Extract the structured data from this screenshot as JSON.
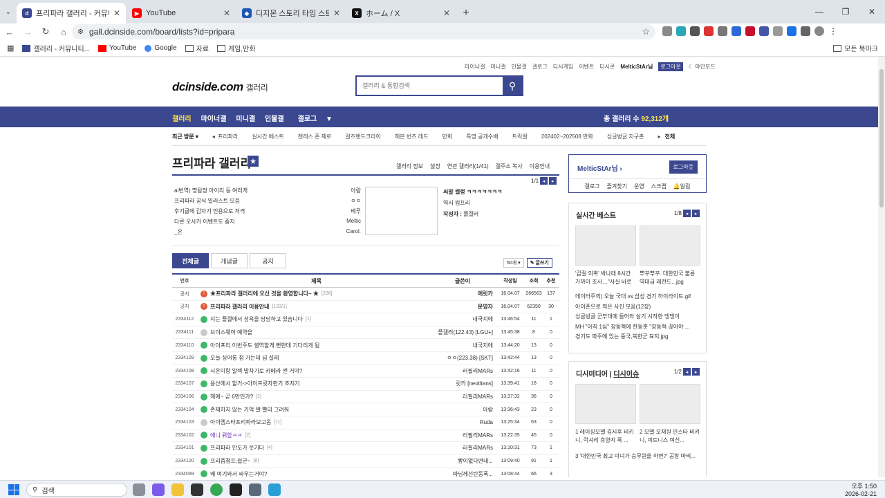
{
  "browser": {
    "tabs": [
      {
        "label": "프리파라 갤러리 - 커뮤니티 포",
        "active": true,
        "color": "#3b4890"
      },
      {
        "label": "YouTube",
        "active": false,
        "color": "#ff0000"
      },
      {
        "label": "디지몬 스토리 타임 스트레인저",
        "active": false,
        "color": "#1f56b3"
      },
      {
        "label": "ホーム / X",
        "active": false,
        "color": "#111111"
      }
    ],
    "url": "gall.dcinside.com/board/lists?id=pripara",
    "bookmarks": [
      "갤러리 - 커뮤니티...",
      "YouTube",
      "Google",
      "자료",
      "게임,만화"
    ],
    "bookmarks_right": "모든 북마크"
  },
  "site": {
    "toplinks": [
      "마이너갤",
      "미니갤",
      "인물갤",
      "갤로그",
      "디시게임",
      "이벤트",
      "디시콘"
    ],
    "user": "MelticStAr님",
    "logout": "로그아웃",
    "night": "야간모드",
    "logo": "dcinside.com",
    "logo_sub": "갤러리",
    "search_placeholder": "갤러리 & 통합검색",
    "gnb": [
      "갤러리",
      "마이너갤",
      "미니갤",
      "인물갤",
      "갤로그"
    ],
    "total_label": "총 갤러리 수",
    "total_value": "92,312개",
    "recent_label": "최근 방문",
    "recent": [
      "프리파라",
      "실시간 베스트",
      "젠레스 존 제로",
      "걸즈밴드크라이",
      "헤븐 번즈 레드",
      "만화",
      "특명 공개수배",
      "트릭컬",
      "202402~202508 만화",
      "싱글벙글 지구촌"
    ],
    "recent_all": "전체"
  },
  "gallery": {
    "title": "프리파라 갤러리",
    "menu": [
      "갤러리 정보",
      "설정",
      "연관 갤러리(1/41)",
      "갤주소 복사",
      "이용안내"
    ],
    "pager": "1/1",
    "notices": [
      {
        "t": "ai번역) 명탐정 아이리 등 여러개",
        "a": "아람"
      },
      {
        "t": "프리파라 공식 일러스트 모음",
        "a": "ㅇㅇ"
      },
      {
        "t": "후기글에 갑자기 인용으로 저격",
        "a": "베루"
      },
      {
        "t": "다른 오사카 이벤트도 중지",
        "a": "Meltic"
      },
      {
        "t": "_온",
        "a": "Carol."
      }
    ],
    "notice_right": {
      "title": "씨발 썰렁 ㅋㅋㅋㅋㅋㅋㅋ",
      "sub": "역시 씹프리",
      "writer_label": "작성자 :",
      "writer": "플갤러"
    },
    "tabs": [
      "전체글",
      "개념글",
      "공지"
    ],
    "count_select": "50개",
    "write": "글쓰기",
    "headers": [
      "번호",
      "제목",
      "글쓴이",
      "작성일",
      "조회",
      "추천"
    ],
    "rows": [
      {
        "no": "공지",
        "ic": "red",
        "title": "★프리파라 갤러리에 오신 것을 환영합니다~ ★",
        "cm": "[206]",
        "b": true,
        "w": "에릿카",
        "d": "16.04.07",
        "v": "266563",
        "r": "137"
      },
      {
        "no": "공지",
        "ic": "red",
        "title": "프리파라 갤러리 이용안내",
        "cm": "[133/1]",
        "b": true,
        "w": "운영자",
        "d": "16.04.07",
        "v": "62350",
        "r": "30"
      },
      {
        "no": "2334112",
        "ic": "grn",
        "title": "지는 플갤에서 성욕을 담당하고 있습니다",
        "cm": "[1]",
        "w": "내국치에",
        "d": "13:46:54",
        "v": "11",
        "r": "1"
      },
      {
        "no": "2334111",
        "ic": "gry",
        "title": "브이스웨어 예약을",
        "cm": "",
        "w": "플갤러(122.43) [LGU+]",
        "d": "13:45:38",
        "v": "8",
        "r": "0"
      },
      {
        "no": "2334110",
        "ic": "grn",
        "title": "아이프리 이번주도 썰역할게 뻔한데 기다리게 됨",
        "cm": "",
        "w": "내국치에",
        "d": "13:44:20",
        "v": "13",
        "r": "0"
      },
      {
        "no": "2334109",
        "ic": "grn",
        "title": "오늘 싱어롱 첨 가는데 넘 설레",
        "cm": "",
        "w": "ㅇㅇ(223.38) [SKT]",
        "d": "13:42:44",
        "v": "13",
        "r": "0"
      },
      {
        "no": "2334108",
        "ic": "grn",
        "title": "시온이랑 알렉 발차기로 카메라 깬 거야?",
        "cm": "",
        "w": "러필리MARs",
        "d": "13:42:16",
        "v": "11",
        "r": "0"
      },
      {
        "no": "2334107",
        "ic": "grn",
        "title": "용산에서 할거->아이프릿자판기 조지기",
        "cm": "",
        "w": "릿카 [neotitans]",
        "d": "13:39:41",
        "v": "18",
        "r": "0"
      },
      {
        "no": "2334106",
        "ic": "grn",
        "title": "헤에~ 곧 6만인가?",
        "cm": "[2]",
        "w": "러필리MARs",
        "d": "13:37:32",
        "v": "36",
        "r": "0"
      },
      {
        "no": "2334104",
        "ic": "grn",
        "title": "존재하지 않는 기억 짤 빨리 그려줘",
        "cm": "",
        "w": "아람",
        "d": "13:36:43",
        "v": "23",
        "r": "0"
      },
      {
        "no": "2334103",
        "ic": "gry",
        "title": "아이엠스타프리파라보고옴",
        "cm": "[11]",
        "w": "Ruda",
        "d": "13:25:34",
        "v": "63",
        "r": "0"
      },
      {
        "no": "2334102",
        "ic": "grn",
        "title": "애니 뭐함ㅋㅋ",
        "cm": "[2]",
        "p": true,
        "w": "러필리MARs",
        "d": "13:22:35",
        "v": "45",
        "r": "0"
      },
      {
        "no": "2334101",
        "ic": "grn",
        "title": "프리파라 안도가 웃기다",
        "cm": "[4]",
        "w": "러필리MARs",
        "d": "13:10:31",
        "v": "73",
        "r": "1"
      },
      {
        "no": "2334100",
        "ic": "grn",
        "title": "프리즘점프,쉽군~",
        "cm": "[8]",
        "w": "빵이없다면내...",
        "d": "13:09:40",
        "v": "91",
        "r": "1"
      },
      {
        "no": "2334099",
        "ic": "grn",
        "title": "왜 여기와서 싸우는거야?",
        "cm": "",
        "w": "따님께선탄동폭...",
        "d": "13:08:44",
        "v": "66",
        "r": "3"
      }
    ]
  },
  "sidebar": {
    "nick": "MelticStAr님",
    "logout": "로그아웃",
    "links": [
      "갤로그",
      "즐겨찾기",
      "운영",
      "스크랩",
      "알림"
    ],
    "best_title": "실시간 베스트",
    "best_pager": "1/8",
    "best_caps": [
      "'갑질 의혹' 박나래 8시간 가까이 조사…\"사실 바로",
      "뿌꾸뿌꾸. 대한민국 불륜 역대급 레전드...jpg"
    ],
    "best_list": [
      "데이터주의) 오늘 국대 vs 삼성 경기 하이라이트.gif",
      "아이폰으로 찍은 사진 모음(12장)",
      "싱글벙글 군부대에 들어와 살기 시작한 댕댕이",
      "MH \"아직 1심\" 장동혁에 한동훈 \"장동혁 끊어야 ...",
      "경기도 파주에 있는 중국,북한군 묘지.jpg"
    ],
    "dc_title": "디시미디어",
    "dc_title2": "디시이슈",
    "dc_pager": "1/2",
    "dc_caps": [
      "1 레이싱모델 김시후 비키니, 럭셔리 휴양지 룩 ...",
      "2 모델 오채원 인스타 비키니, 피트니스 여신..."
    ],
    "dc_list": [
      "3 '대한민국 최고 미녀가 승무원을 하면?' 공항 마비..."
    ]
  },
  "taskbar": {
    "search": "검색",
    "time": "오후 1:50",
    "date": "2026-02-21"
  }
}
